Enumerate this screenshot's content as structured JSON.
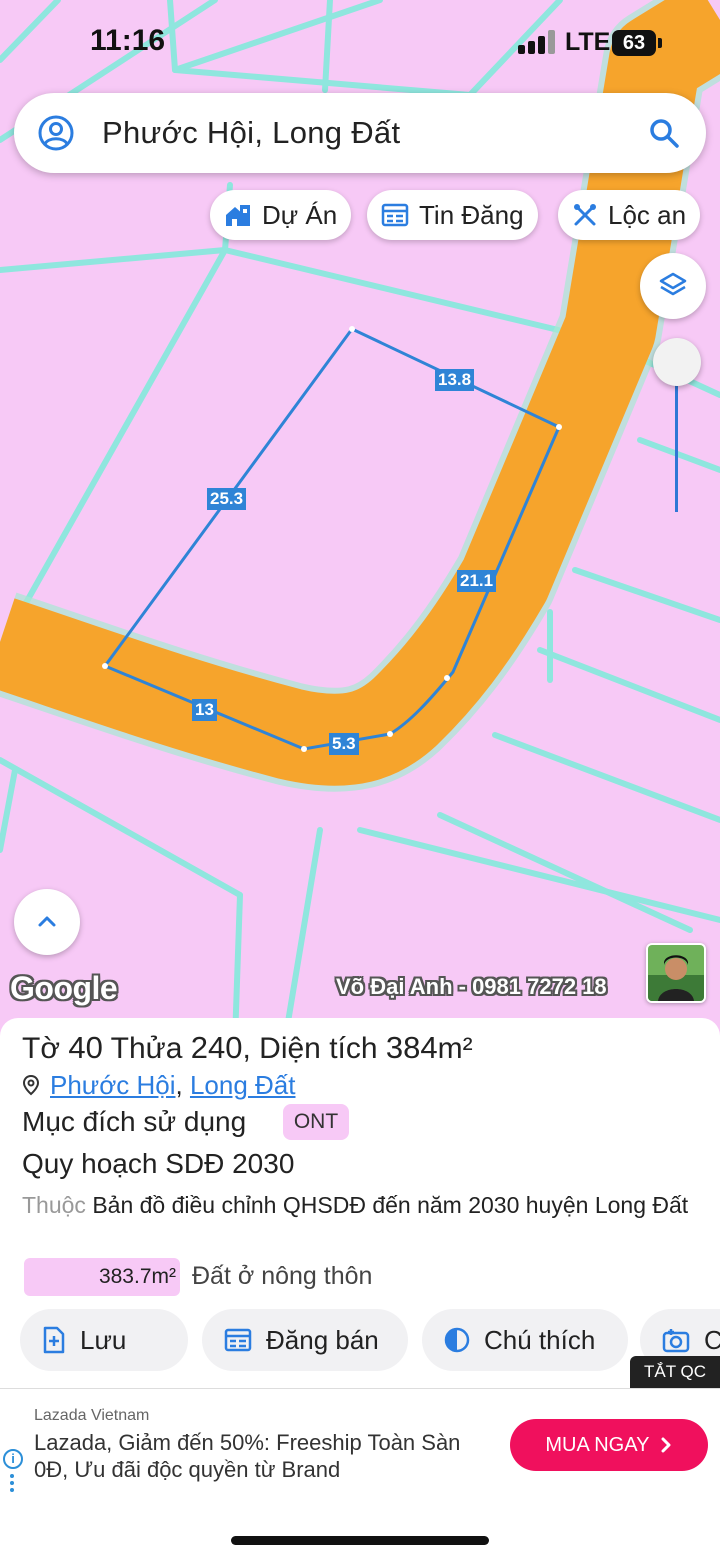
{
  "status": {
    "time": "11:16",
    "network": "LTE",
    "battery": "63"
  },
  "search": {
    "value": "Phước Hội, Long Đất"
  },
  "chips": [
    {
      "label": "Dự Án",
      "icon": "home-city-icon"
    },
    {
      "label": "Tin Đăng",
      "icon": "listing-icon"
    },
    {
      "label": "Lộc an",
      "icon": "tools-icon"
    }
  ],
  "map": {
    "google_label": "Google",
    "watermark": "Võ Đại Anh - 0981 7272 18",
    "edge_labels": [
      "13.8",
      "25.3",
      "21.1",
      "13",
      "5.3"
    ],
    "colors": {
      "land": "#f7c9f6",
      "road": "#f6a42c",
      "boundary": "#8fe6de",
      "plot": "#2f84d6"
    }
  },
  "panel": {
    "sheet_label": "Tờ",
    "sheet_no": "40",
    "parcel_label": "Thửa",
    "parcel_no": "240",
    "area_label": "Diện tích",
    "area_value": "384",
    "area_unit": "m²",
    "location_ward": "Phước Hội",
    "location_sep": ",",
    "location_district": "Long Đất",
    "purpose_label": "Mục đích sử dụng",
    "purpose_code": "ONT",
    "plan_label": "Quy hoạch SDĐ 2030",
    "belong_prefix": "Thuộc",
    "belong_text": "Bản đồ điều chỉnh QHSDĐ đến năm 2030 huyện Long Đất",
    "zone_area": "383.7m²",
    "zone_label": "Đất ở nông thôn"
  },
  "actions": [
    {
      "label": "Lưu",
      "icon": "save-add-icon"
    },
    {
      "label": "Đăng bán",
      "icon": "listing-icon"
    },
    {
      "label": "Chú thích",
      "icon": "legend-icon"
    },
    {
      "label": "C",
      "icon": "camera-icon"
    }
  ],
  "ad": {
    "close_label": "TẮT QC",
    "brand": "Lazada Vietnam",
    "text": "Lazada, Giảm đến 50%: Freeship Toàn Sàn 0Đ, Ưu đãi độc quyền từ Brand",
    "cta": "MUA NGAY",
    "cta_color": "#f0105d"
  }
}
